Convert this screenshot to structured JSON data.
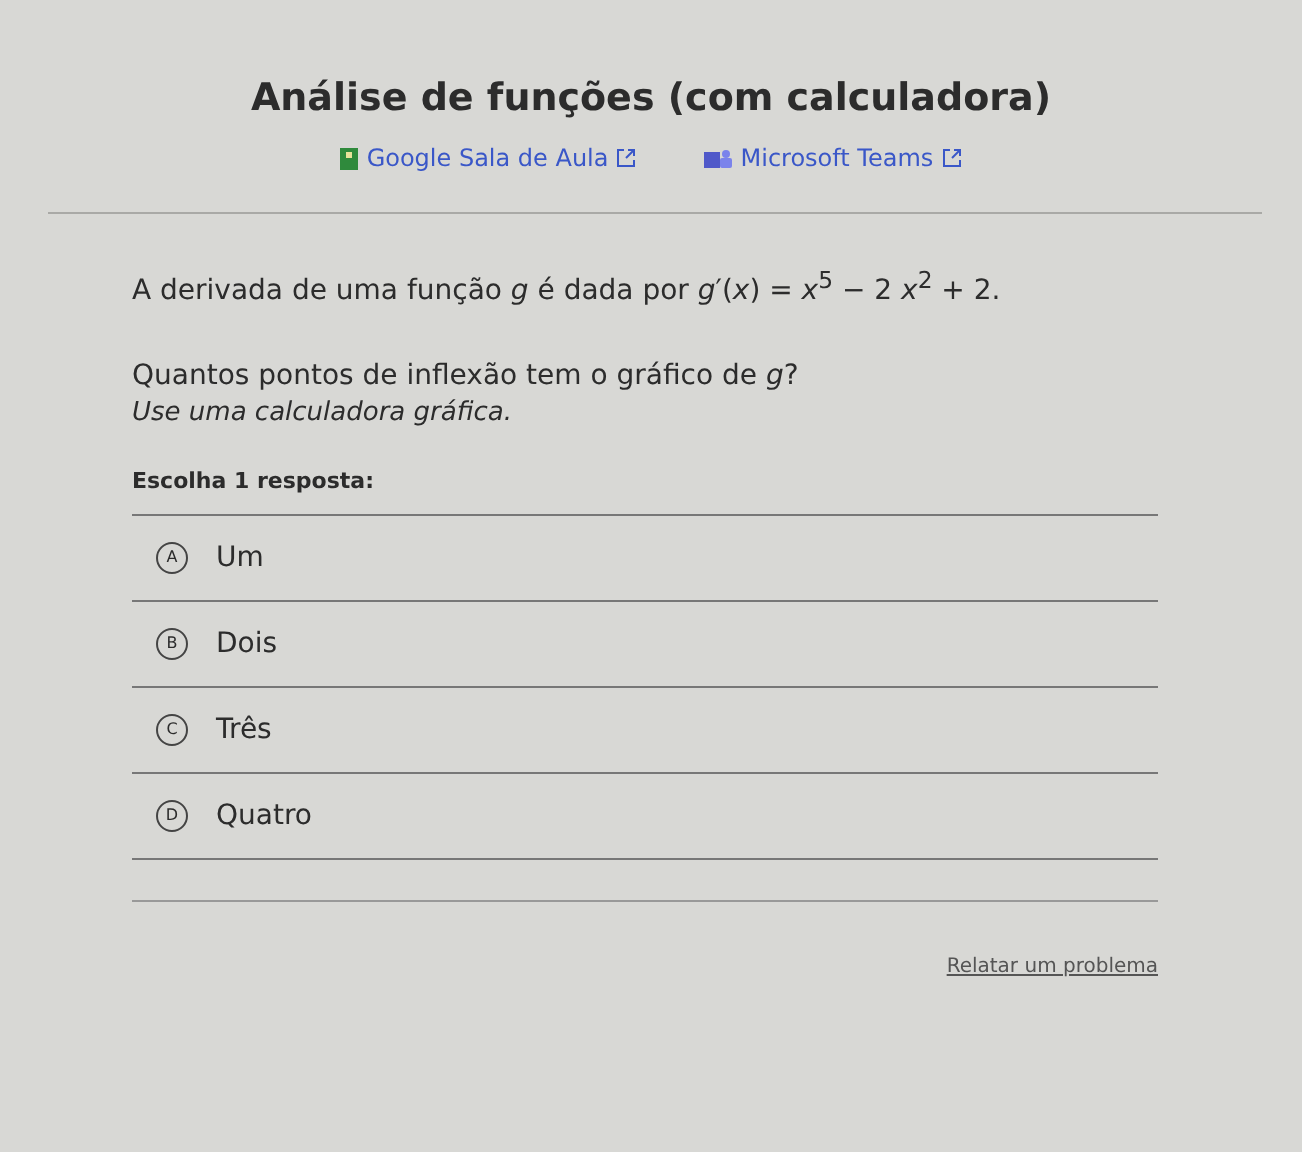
{
  "title": "Análise de funções (com calculadora)",
  "links": [
    {
      "kind": "classroom",
      "label": "Google Sala de Aula"
    },
    {
      "kind": "teams",
      "label": "Microsoft Teams"
    }
  ],
  "problem": "A derivada de uma função *g* é dada por *g*′(*x*) = *x*$^{5}$ − 2 *x*$^{2}$ + 2.",
  "question": "Quantos pontos de inflexão tem o gráfico de *g*?",
  "hint": "Use uma calculadora gráfica.",
  "prompt": "Escolha 1 resposta:",
  "choices": [
    {
      "letter": "A",
      "label": "Um",
      "selected": false
    },
    {
      "letter": "B",
      "label": "Dois",
      "selected": false
    },
    {
      "letter": "C",
      "label": "Três",
      "selected": false
    },
    {
      "letter": "D",
      "label": "Quatro",
      "selected": false
    }
  ],
  "report_link": "Relatar um problema"
}
